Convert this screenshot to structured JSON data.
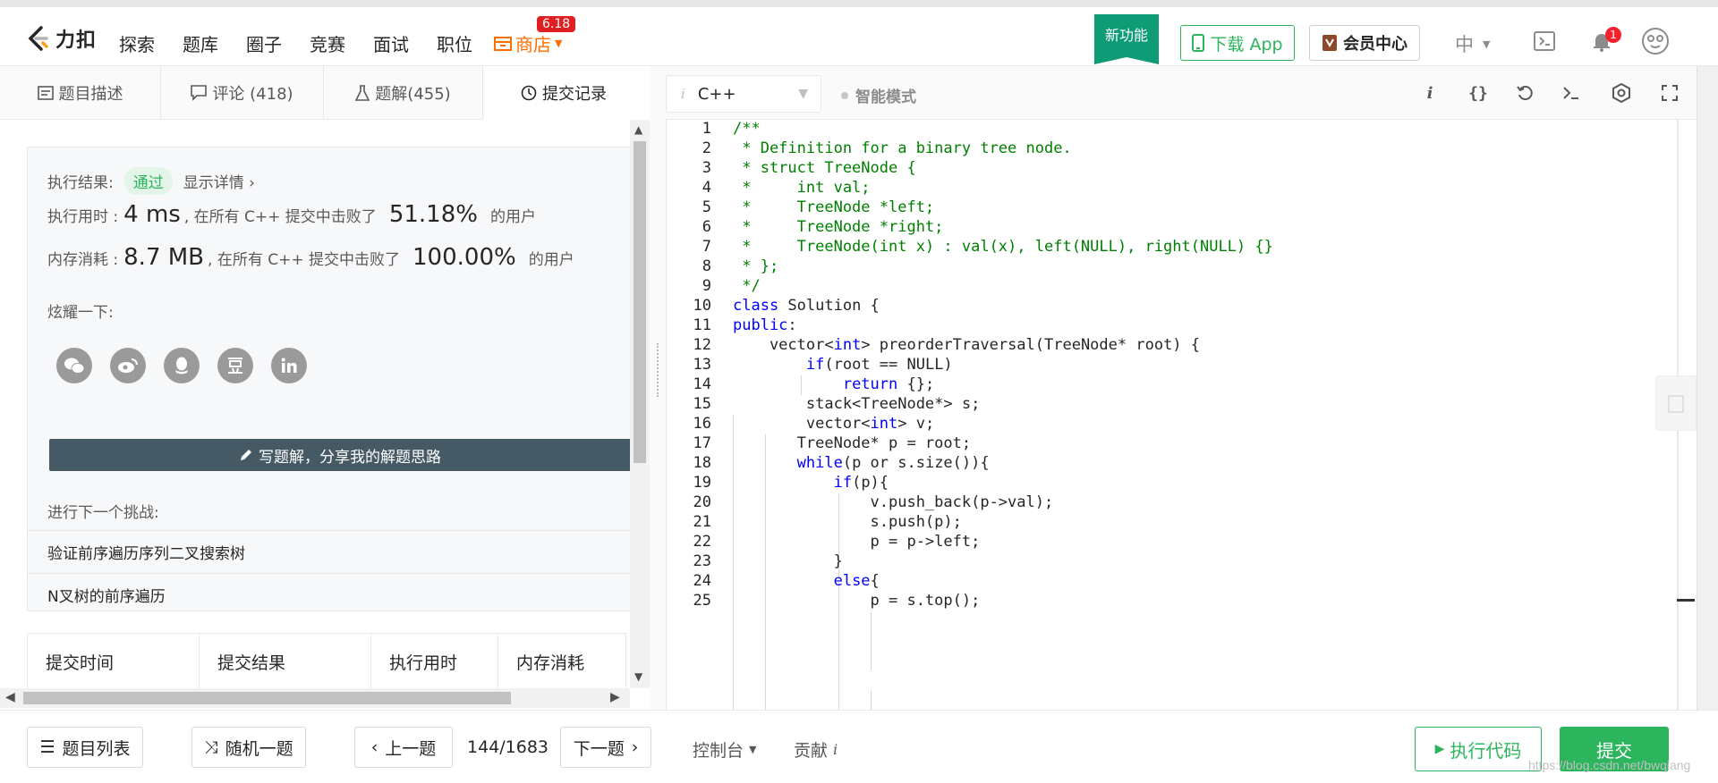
{
  "nav": {
    "logo_text": "力扣",
    "items": [
      "探索",
      "题库",
      "圈子",
      "竞赛",
      "面试",
      "职位"
    ],
    "store": "商店",
    "store_badge": "6.18",
    "new_feature": "新功能",
    "download_app": "下载 App",
    "vip_center": "会员中心",
    "language": "中",
    "notification_count": "1"
  },
  "left_tabs": [
    {
      "label": "题目描述",
      "icon": "description-icon"
    },
    {
      "label": "评论 (418)",
      "icon": "comment-icon"
    },
    {
      "label": "题解(455)",
      "icon": "flask-icon"
    },
    {
      "label": "提交记录",
      "icon": "clock-icon",
      "active": true
    }
  ],
  "result": {
    "label": "执行结果:",
    "status": "通过",
    "detail_link": "显示详情 ›",
    "runtime_label": "执行用时 :",
    "runtime_value": "4 ms",
    "runtime_desc": ", 在所有 C++ 提交中击败了",
    "runtime_percent": "51.18%",
    "users_suffix": "的用户",
    "memory_label": "内存消耗 :",
    "memory_value": "8.7 MB",
    "memory_desc": ", 在所有 C++ 提交中击败了",
    "memory_percent": "100.00%",
    "share_label": "炫耀一下:",
    "social": [
      "wechat",
      "weibo",
      "qq",
      "douban",
      "linkedin"
    ],
    "write_solution": "写题解，分享我的解题思路",
    "next_challenge_label": "进行下一个挑战:",
    "challenges": [
      "验证前序遍历序列二叉搜索树",
      "N叉树的前序遍历"
    ]
  },
  "submission_table": {
    "headers": [
      "提交时间",
      "提交结果",
      "执行用时",
      "内存消耗"
    ]
  },
  "editor": {
    "language": "C++",
    "smart_mode": "智能模式",
    "lines": [
      {
        "n": "1",
        "text": "/**",
        "cls": "c-comment"
      },
      {
        "n": "2",
        "text": " * Definition for a binary tree node.",
        "cls": "c-comment"
      },
      {
        "n": "3",
        "text": " * struct TreeNode {",
        "cls": "c-comment"
      },
      {
        "n": "4",
        "text": " *     int val;",
        "cls": "c-comment"
      },
      {
        "n": "5",
        "text": " *     TreeNode *left;",
        "cls": "c-comment"
      },
      {
        "n": "6",
        "text": " *     TreeNode *right;",
        "cls": "c-comment"
      },
      {
        "n": "7",
        "text": " *     TreeNode(int x) : val(x), left(NULL), right(NULL) {}",
        "cls": "c-comment"
      },
      {
        "n": "8",
        "text": " * };",
        "cls": "c-comment"
      },
      {
        "n": "9",
        "text": " */",
        "cls": "c-comment"
      },
      {
        "n": "10",
        "html": "<span class='c-kw'>class</span> Solution {"
      },
      {
        "n": "11",
        "html": "<span class='c-kw'>public</span>:"
      },
      {
        "n": "12",
        "html": "    vector&lt;<span class='c-kw'>int</span>&gt; preorderTraversal(TreeNode* root) {"
      },
      {
        "n": "13",
        "html": "        <span class='c-kw'>if</span>(root == NULL)"
      },
      {
        "n": "14",
        "html": "            <span class='c-kw'>return</span> {};"
      },
      {
        "n": "15",
        "html": "        stack&lt;TreeNode*&gt; s;"
      },
      {
        "n": "16",
        "html": "        vector&lt;<span class='c-kw'>int</span>&gt; v;"
      },
      {
        "n": "17",
        "html": "       TreeNode* p = root;"
      },
      {
        "n": "18",
        "html": "       <span class='c-kw'>while</span>(p or s.size()){"
      },
      {
        "n": "19",
        "html": "           <span class='c-kw'>if</span>(p){"
      },
      {
        "n": "20",
        "html": "               v.push_back(p-&gt;val);"
      },
      {
        "n": "21",
        "html": "               s.push(p);"
      },
      {
        "n": "22",
        "html": "               p = p-&gt;left;"
      },
      {
        "n": "23",
        "html": "           }"
      },
      {
        "n": "24",
        "html": "           <span class='c-kw'>else</span>{"
      },
      {
        "n": "25",
        "html": "               p = s.top();"
      }
    ]
  },
  "bottom": {
    "problem_list": "题目列表",
    "random": "随机一题",
    "prev": "上一题",
    "page": "144/1683",
    "next": "下一题",
    "console": "控制台",
    "contribute": "贡献",
    "run_code": "执行代码",
    "submit": "提交"
  },
  "watermark": "https://blog.csdn.net/bwqiang"
}
